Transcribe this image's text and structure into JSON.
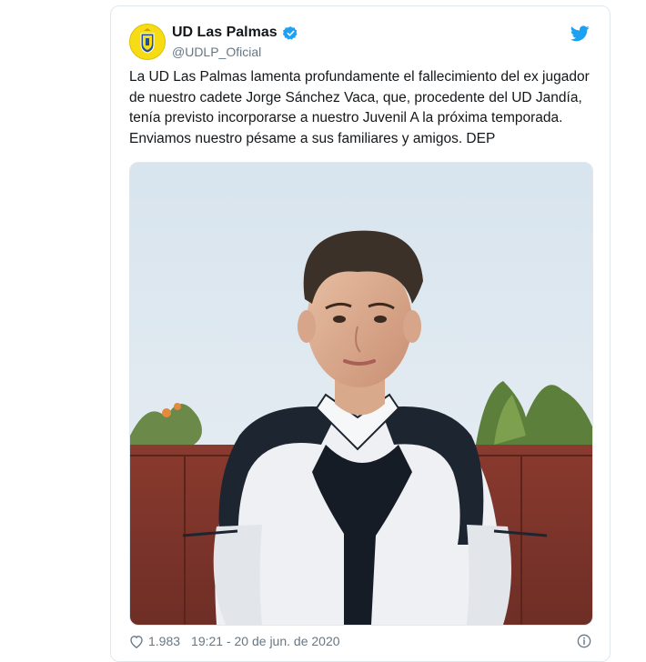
{
  "tweet": {
    "display_name": "UD Las Palmas",
    "handle": "@UDLP_Oficial",
    "verified_icon": "verified-badge-icon",
    "platform_icon": "twitter-bird-icon",
    "text": "La UD Las Palmas lamenta profundamente el fallecimiento del ex jugador de nuestro cadete Jorge Sánchez Vaca, que, procedente del UD Jandía, tenía previsto incorporarse a nuestro Juvenil A la próxima temporada. Enviamos nuestro pésame a sus familiares y amigos. DEP",
    "likes": "1.983",
    "timestamp": "19:21 - 20 de jun. de 2020"
  },
  "colors": {
    "brand_blue": "#1da1f2",
    "text": "#14171a",
    "muted": "#657786",
    "avatar_yellow": "#f5d90a"
  }
}
